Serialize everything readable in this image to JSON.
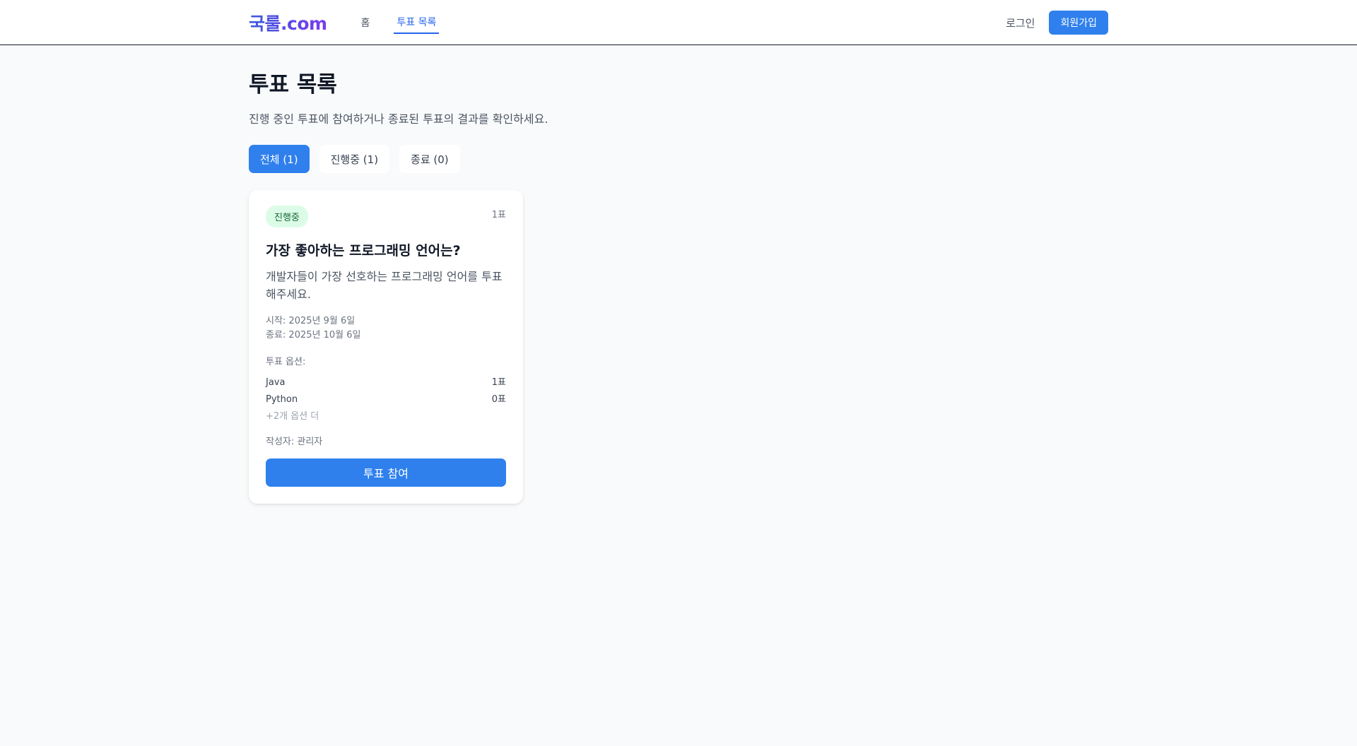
{
  "header": {
    "logo": "국룰.com",
    "nav": [
      {
        "label": "홈",
        "active": false
      },
      {
        "label": "투표 목록",
        "active": true
      }
    ],
    "login_label": "로그인",
    "signup_label": "회원가입"
  },
  "page": {
    "title": "투표 목록",
    "subtitle": "진행 중인 투표에 참여하거나 종료된 투표의 결과를 확인하세요."
  },
  "filters": [
    {
      "label": "전체 (1)",
      "active": true
    },
    {
      "label": "진행중 (1)",
      "active": false
    },
    {
      "label": "종료 (0)",
      "active": false
    }
  ],
  "polls": [
    {
      "status": "진행중",
      "vote_count": "1표",
      "title": "가장 좋아하는 프로그래밍 언어는?",
      "description": "개발자들이 가장 선호하는 프로그래밍 언어를 투표해주세요.",
      "start": "시작: 2025년 9월 6일",
      "end": "종료: 2025년 10월 6일",
      "options_label": "투표 옵션:",
      "options": [
        {
          "name": "Java",
          "votes": "1표"
        },
        {
          "name": "Python",
          "votes": "0표"
        }
      ],
      "more_options": "+2개 옵션 더",
      "author": "작성자: 관리자",
      "join_label": "투표 참여"
    }
  ],
  "colors": {
    "accent": "#2f80ed",
    "status_bg": "#dcfce7",
    "status_text": "#166534",
    "page_bg": "#f9fafb"
  }
}
